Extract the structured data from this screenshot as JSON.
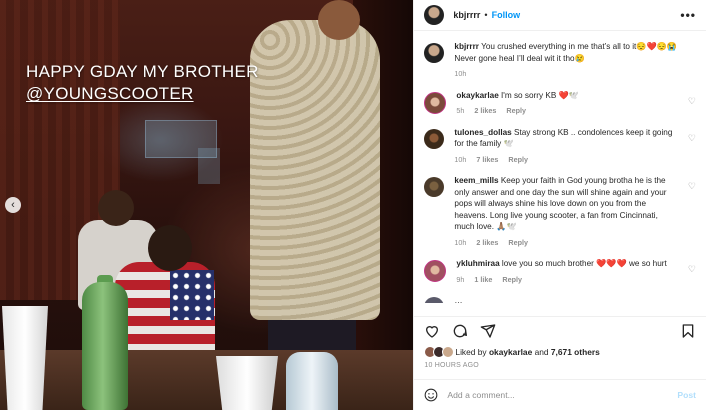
{
  "post": {
    "overlay_line1": "HAPPY GDAY MY BROTHER",
    "overlay_line2": "@YOUNGSCOOTER",
    "prev_glyph": "‹"
  },
  "header": {
    "username": "kbjrrrr",
    "separator": "•",
    "follow_label": "Follow",
    "more_glyph": "•••"
  },
  "caption": {
    "username": "kbjrrrr",
    "text": "You crushed everything in me that’s all to it😔❤️😔😭 Never gone heal I’ll deal wit it tho😢",
    "time": "10h"
  },
  "comments": [
    {
      "username": "okaykarlae",
      "text": "I'm so sorry KB ❤️🕊️",
      "time": "5h",
      "likes": "2 likes",
      "reply": "Reply"
    },
    {
      "username": "tulones_dollas",
      "text": "Stay strong KB .. condolences keep it going for the family 🕊️",
      "time": "10h",
      "likes": "7 likes",
      "reply": "Reply"
    },
    {
      "username": "keem_mills",
      "text": "Keep your faith in God young brotha he is the only answer and one day the sun will shine again and your pops will always shine his love down on you from the heavens. Long live young scooter, a fan from Cincinnati, much love. 🙏🏽🕊️",
      "time": "10h",
      "likes": "2 likes",
      "reply": "Reply"
    },
    {
      "username": "ykluhmiraa",
      "text": "love you so much brother ❤️❤️❤️ we so hurt",
      "time": "9h",
      "likes": "1 like",
      "reply": "Reply"
    },
    {
      "username": "",
      "text": "…",
      "time": "",
      "likes": "",
      "reply": ""
    }
  ],
  "likes": {
    "prefix": "Liked by",
    "user": "okaykarlae",
    "and": "and",
    "others": "7,671 others"
  },
  "timestamp": "10 HOURS AGO",
  "add_comment": {
    "placeholder": "Add a comment...",
    "post_label": "Post"
  },
  "colors": {
    "accent": "#0095f6",
    "muted": "#8e8e8e",
    "post_disabled": "#b2dffc"
  },
  "icons": [
    "heart-icon",
    "comment-icon",
    "share-icon",
    "bookmark-icon",
    "emoji-icon",
    "more-icon",
    "chevron-left-icon"
  ]
}
